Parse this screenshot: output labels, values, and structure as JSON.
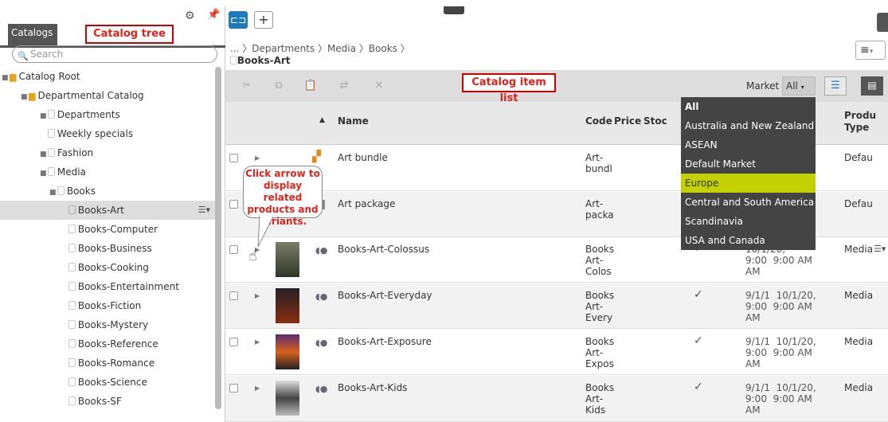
{
  "catalogs_tab": "Catalogs",
  "callouts": {
    "tree": "Catalog tree",
    "list": "Catalog item list",
    "arrow": "Click arrow to display related products and variants."
  },
  "search_placeholder": "Search",
  "tree": [
    {
      "label": "Catalog Root"
    },
    {
      "label": "Departmental Catalog"
    },
    {
      "label": "Departments"
    },
    {
      "label": "Weekly specials"
    },
    {
      "label": "Fashion"
    },
    {
      "label": "Media"
    },
    {
      "label": "Books"
    },
    {
      "label": "Books-Art"
    },
    {
      "label": "Books-Computer"
    },
    {
      "label": "Books-Business"
    },
    {
      "label": "Books-Cooking"
    },
    {
      "label": "Books-Entertainment"
    },
    {
      "label": "Books-Fiction"
    },
    {
      "label": "Books-Mystery"
    },
    {
      "label": "Books-Reference"
    },
    {
      "label": "Books-Romance"
    },
    {
      "label": "Books-Science"
    },
    {
      "label": "Books-SF"
    }
  ],
  "breadcrumb": "... 〉Departments 〉Media 〉Books 〉",
  "page_title": "Books-Art",
  "market": {
    "label": "Market",
    "value": "All"
  },
  "columns": {
    "name": "Name",
    "code": "Code",
    "price": "Price",
    "stock": "Stoc",
    "product_type": "Produ\nType"
  },
  "dropdown": [
    "All",
    "Australia and New Zealand",
    "ASEAN",
    "Default Market",
    "Europe",
    "Central and South America",
    "Scandinavia",
    "USA and Canada"
  ],
  "rows": [
    {
      "name": "Art bundle",
      "code": "Art-\nbundl",
      "dates": "",
      "type": "Defau",
      "check": false
    },
    {
      "name": "Art package",
      "code": "Art-\npacka",
      "dates": "",
      "type": "Defau",
      "check": false
    },
    {
      "name": "Books-Art-Colossus",
      "code": "Books\nArt-\nColos",
      "dates": "10/1/20,\n9:00  9:00 AM\nAM",
      "type": "Media",
      "check": true
    },
    {
      "name": "Books-Art-Everyday",
      "code": "Books\nArt-\nEvery",
      "dates": "9/1/1  10/1/20,\n9:00  9:00 AM\nAM",
      "type": "Media",
      "check": true
    },
    {
      "name": "Books-Art-Exposure",
      "code": "Books\nArt-\nExpos",
      "dates": "9/1/1  10/1/20,\n9:00  9:00 AM\nAM",
      "type": "Media",
      "check": true
    },
    {
      "name": "Books-Art-Kids",
      "code": "Books\nArt-\nKids",
      "dates": "9/1/1  10/1/20,\n9:00  9:00 AM\nAM",
      "type": "Media",
      "check": true
    }
  ],
  "colors": {
    "accent": "#1d7bbd",
    "callout": "#e0231c",
    "selected_market": "#c4d100"
  }
}
